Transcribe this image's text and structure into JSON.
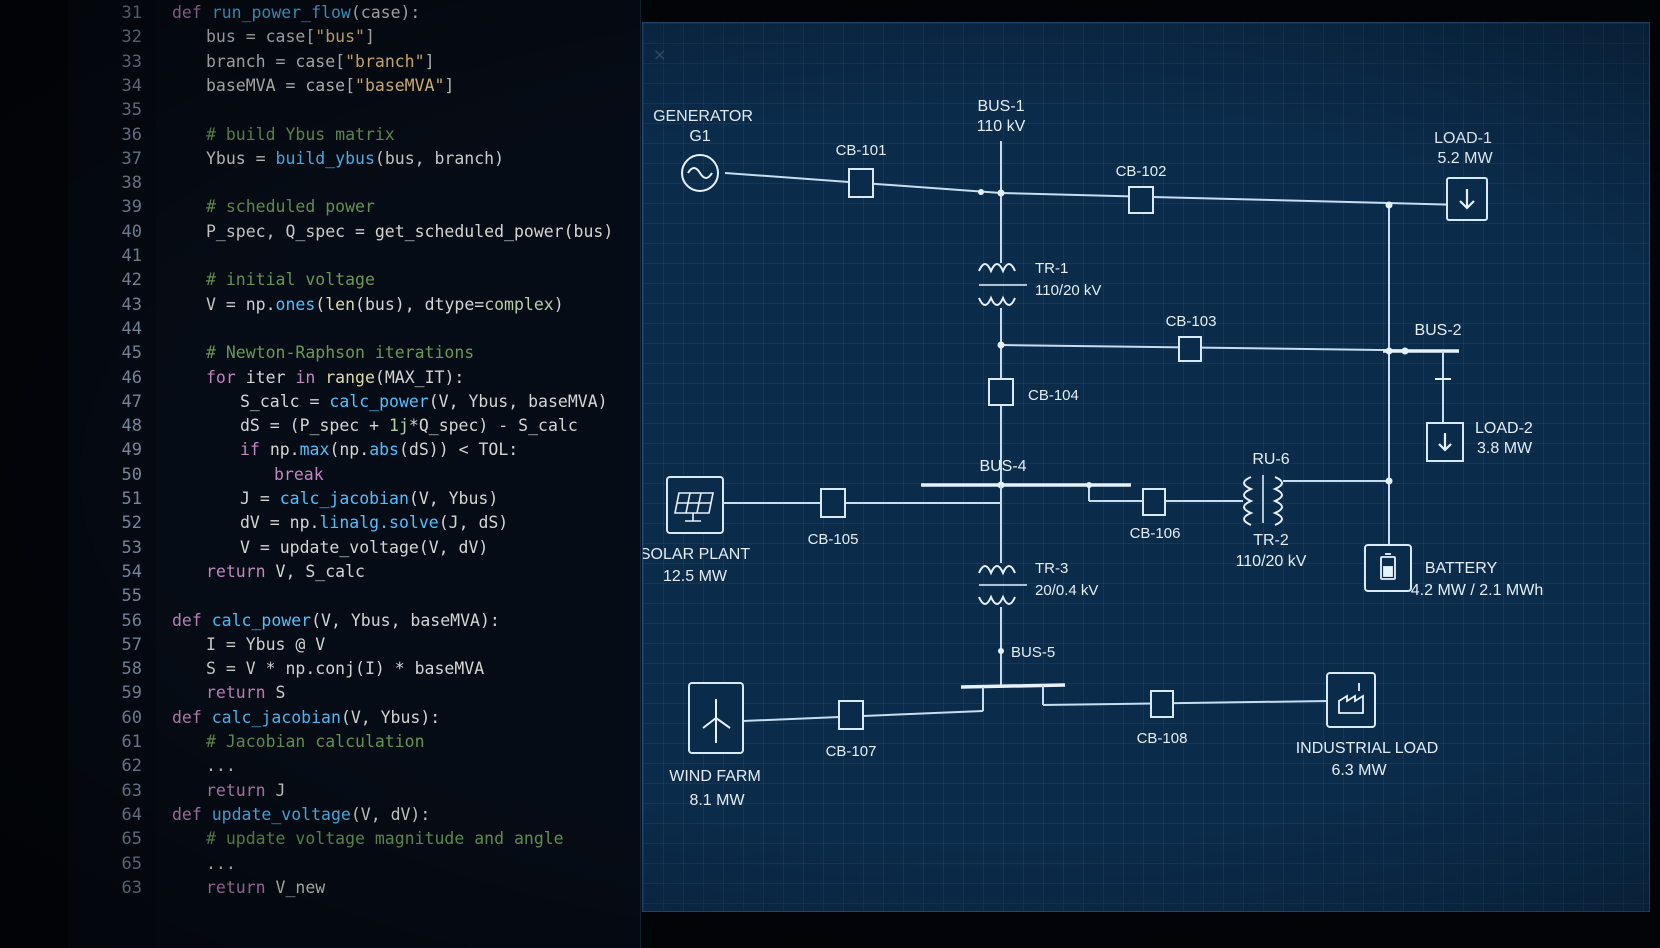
{
  "editor": {
    "lines": [
      {
        "n": "31",
        "segs": [
          [
            "kw",
            "def "
          ],
          [
            "fn",
            "run_power_flow"
          ],
          [
            "vr",
            "(case):"
          ]
        ],
        "indent": 0
      },
      {
        "n": "32",
        "segs": [
          [
            "vr",
            "bus = case["
          ],
          [
            "str",
            "\"bus\""
          ],
          [
            "vr",
            "]"
          ]
        ],
        "indent": 1
      },
      {
        "n": "33",
        "segs": [
          [
            "vr",
            "branch = case["
          ],
          [
            "str",
            "\"branch\""
          ],
          [
            "vr",
            "]"
          ]
        ],
        "indent": 1
      },
      {
        "n": "34",
        "segs": [
          [
            "vr",
            "baseMVA = case["
          ],
          [
            "str",
            "\"baseMVA\""
          ],
          [
            "vr",
            "]"
          ]
        ],
        "indent": 1
      },
      {
        "n": "35",
        "segs": [],
        "indent": 0
      },
      {
        "n": "36",
        "segs": [
          [
            "cm",
            "# build Ybus matrix"
          ]
        ],
        "indent": 1
      },
      {
        "n": "37",
        "segs": [
          [
            "vr",
            "Ybus = "
          ],
          [
            "fn",
            "build_ybus"
          ],
          [
            "vr",
            "(bus, branch)"
          ]
        ],
        "indent": 1
      },
      {
        "n": "38",
        "segs": [],
        "indent": 0
      },
      {
        "n": "39",
        "segs": [
          [
            "cm",
            "# scheduled power"
          ]
        ],
        "indent": 1
      },
      {
        "n": "40",
        "segs": [
          [
            "vr",
            "P_spec, Q_spec = get_scheduled_power(bus)"
          ]
        ],
        "indent": 1
      },
      {
        "n": "41",
        "segs": [],
        "indent": 0
      },
      {
        "n": "42",
        "segs": [
          [
            "cm",
            "# initial voltage"
          ]
        ],
        "indent": 1
      },
      {
        "n": "43",
        "segs": [
          [
            "vr",
            "V = np."
          ],
          [
            "fn",
            "ones"
          ],
          [
            "vr",
            "("
          ],
          [
            "bi",
            "len"
          ],
          [
            "vr",
            "(bus), dtype="
          ],
          [
            "num",
            "complex"
          ],
          [
            "vr",
            ")"
          ]
        ],
        "indent": 1
      },
      {
        "n": "44",
        "segs": [],
        "indent": 0
      },
      {
        "n": "45",
        "segs": [
          [
            "cm",
            "# Newton-Raphson iterations"
          ]
        ],
        "indent": 1
      },
      {
        "n": "46",
        "segs": [
          [
            "kw",
            "for "
          ],
          [
            "vr",
            "iter "
          ],
          [
            "kw",
            "in "
          ],
          [
            "bi",
            "range"
          ],
          [
            "vr",
            "(MAX_IT):"
          ]
        ],
        "indent": 1
      },
      {
        "n": "47",
        "segs": [
          [
            "vr",
            "S_calc = "
          ],
          [
            "fn",
            "calc_power"
          ],
          [
            "vr",
            "(V, Ybus, baseMVA)"
          ]
        ],
        "indent": 2
      },
      {
        "n": "48",
        "segs": [
          [
            "vr",
            "dS = (P_spec + "
          ],
          [
            "num",
            "1j"
          ],
          [
            "vr",
            "*Q_spec) - S_calc"
          ]
        ],
        "indent": 2
      },
      {
        "n": "49",
        "segs": [
          [
            "kw",
            "if "
          ],
          [
            "vr",
            "np."
          ],
          [
            "fn",
            "max"
          ],
          [
            "vr",
            "(np."
          ],
          [
            "fn",
            "abs"
          ],
          [
            "vr",
            "(dS)) < TOL:"
          ]
        ],
        "indent": 2
      },
      {
        "n": "50",
        "segs": [
          [
            "kw",
            "break"
          ]
        ],
        "indent": 3
      },
      {
        "n": "51",
        "segs": [
          [
            "vr",
            "J = "
          ],
          [
            "fn",
            "calc_jacobian"
          ],
          [
            "vr",
            "(V, Ybus)"
          ]
        ],
        "indent": 2
      },
      {
        "n": "52",
        "segs": [
          [
            "vr",
            "dV = np."
          ],
          [
            "fn",
            "linalg.solve"
          ],
          [
            "vr",
            "(J, dS)"
          ]
        ],
        "indent": 2
      },
      {
        "n": "53",
        "segs": [
          [
            "vr",
            "V = update_voltage(V, dV)"
          ]
        ],
        "indent": 2
      },
      {
        "n": "54",
        "segs": [
          [
            "kw",
            "return "
          ],
          [
            "vr",
            "V, S_calc"
          ]
        ],
        "indent": 1
      },
      {
        "n": "55",
        "segs": [],
        "indent": 0
      },
      {
        "n": "56",
        "segs": [
          [
            "kw",
            "def "
          ],
          [
            "fn",
            "calc_power"
          ],
          [
            "vr",
            "(V, Ybus, baseMVA):"
          ]
        ],
        "indent": 0
      },
      {
        "n": "57",
        "segs": [
          [
            "vr",
            "I = Ybus @ V"
          ]
        ],
        "indent": 1
      },
      {
        "n": "58",
        "segs": [
          [
            "vr",
            "S = V * np.conj(I) * baseMVA"
          ]
        ],
        "indent": 1
      },
      {
        "n": "59",
        "segs": [
          [
            "kw",
            "return "
          ],
          [
            "vr",
            "S"
          ]
        ],
        "indent": 1
      },
      {
        "n": "60",
        "segs": [
          [
            "kw",
            "def "
          ],
          [
            "fn",
            "calc_jacobian"
          ],
          [
            "vr",
            "(V, Ybus):"
          ]
        ],
        "indent": 0
      },
      {
        "n": "61",
        "segs": [
          [
            "cm",
            "# Jacobian calculation"
          ]
        ],
        "indent": 1
      },
      {
        "n": "62",
        "segs": [
          [
            "vr",
            "..."
          ]
        ],
        "indent": 1
      },
      {
        "n": "63",
        "segs": [
          [
            "kw",
            "return "
          ],
          [
            "vr",
            "J"
          ]
        ],
        "indent": 1
      },
      {
        "n": "64",
        "segs": [
          [
            "kw",
            "def "
          ],
          [
            "fn",
            "update_voltage"
          ],
          [
            "vr",
            "(V, dV):"
          ]
        ],
        "indent": 0
      },
      {
        "n": "65",
        "segs": [
          [
            "cm",
            "# update voltage magnitude and angle"
          ]
        ],
        "indent": 1
      },
      {
        "n": "65",
        "segs": [
          [
            "vr",
            "..."
          ]
        ],
        "indent": 1
      },
      {
        "n": "63",
        "segs": [
          [
            "kw",
            "return "
          ],
          [
            "vr",
            "V_new"
          ]
        ],
        "indent": 1
      }
    ]
  },
  "diagram": {
    "close_icon": "×",
    "generator": {
      "name": "GENERATOR",
      "id": "G1"
    },
    "bus1": {
      "name": "BUS-1",
      "rating": "110 kV"
    },
    "cb101": "CB-101",
    "cb102": "CB-102",
    "cb103": "CB-103",
    "cb104": "CB-104",
    "cb105": "CB-105",
    "cb106": "CB-106",
    "cb107": "CB-107",
    "cb108": "CB-108",
    "load1": {
      "name": "LOAD-1",
      "rating": "5.2 MW"
    },
    "tr1": {
      "name": "TR-1",
      "rating": "110/20 kV"
    },
    "bus2": {
      "name": "BUS-2"
    },
    "load2": {
      "name": "LOAD-2",
      "rating": "3.8 MW"
    },
    "bus4": {
      "name": "BUS-4"
    },
    "ru6": {
      "name": "RU-6"
    },
    "tr2": {
      "name": "TR-2",
      "rating": "110/20 kV"
    },
    "solar": {
      "name": "SOLAR PLANT",
      "rating": "12.5 MW"
    },
    "battery": {
      "name": "BATTERY",
      "rating": "4.2 MW / 2.1 MWh"
    },
    "tr3": {
      "name": "TR-3",
      "rating": "20/0.4 kV"
    },
    "bus5": {
      "name": "BUS-5"
    },
    "wind": {
      "name": "WIND FARM",
      "rating": "8.1 MW"
    },
    "industrial": {
      "name": "INDUSTRIAL LOAD",
      "rating": "6.3 MW"
    }
  }
}
